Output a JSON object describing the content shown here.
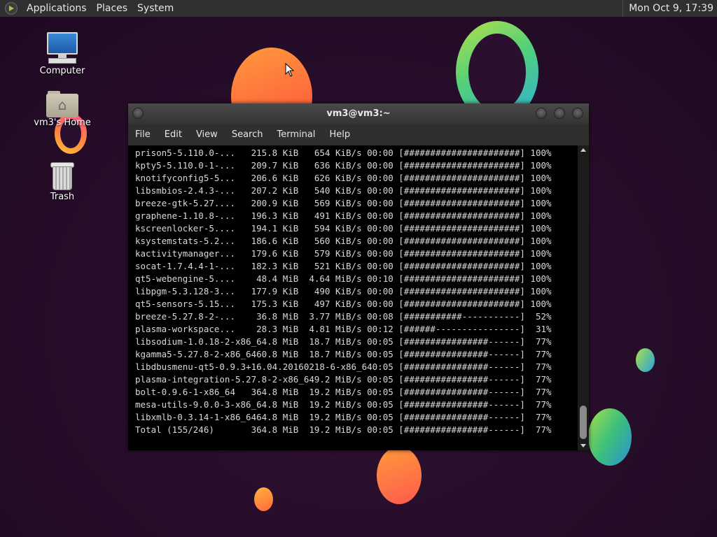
{
  "panel": {
    "menus": [
      "Applications",
      "Places",
      "System"
    ],
    "clock": "Mon Oct  9, 17:39"
  },
  "desktop": {
    "icons": [
      {
        "label": "Computer",
        "icon": "computer-icon"
      },
      {
        "label": "vm3's Home",
        "icon": "home-folder-icon"
      },
      {
        "label": "Trash",
        "icon": "trash-icon"
      }
    ]
  },
  "terminal": {
    "title": "vm3@vm3:~",
    "menus": [
      "File",
      "Edit",
      "View",
      "Search",
      "Terminal",
      "Help"
    ],
    "lines": [
      "prison5-5.110.0-...   215.8 KiB   654 KiB/s 00:00 [######################] 100%",
      "kpty5-5.110.0-1-...   209.7 KiB   636 KiB/s 00:00 [######################] 100%",
      "knotifyconfig5-5...   206.6 KiB   626 KiB/s 00:00 [######################] 100%",
      "libsmbios-2.4.3-...   207.2 KiB   540 KiB/s 00:00 [######################] 100%",
      "breeze-gtk-5.27....   200.9 KiB   569 KiB/s 00:00 [######################] 100%",
      "graphene-1.10.8-...   196.3 KiB   491 KiB/s 00:00 [######################] 100%",
      "kscreenlocker-5....   194.1 KiB   594 KiB/s 00:00 [######################] 100%",
      "ksystemstats-5.2...   186.6 KiB   560 KiB/s 00:00 [######################] 100%",
      "kactivitymanager...   179.6 KiB   579 KiB/s 00:00 [######################] 100%",
      "socat-1.7.4.4-1-...   182.3 KiB   521 KiB/s 00:00 [######################] 100%",
      "qt5-webengine-5....    48.4 MiB  4.64 MiB/s 00:10 [######################] 100%",
      "libpgm-5.3.128-3...   177.9 KiB   490 KiB/s 00:00 [######################] 100%",
      "qt5-sensors-5.15...   175.3 KiB   497 KiB/s 00:00 [######################] 100%",
      "breeze-5.27.8-2-...    36.8 MiB  3.77 MiB/s 00:08 [###########-----------]  52%",
      "plasma-workspace...    28.3 MiB  4.81 MiB/s 00:12 [######----------------]  31%",
      "libsodium-1.0.18-2-x86_64.8 MiB  18.7 MiB/s 00:05 [################------]  77%",
      "kgamma5-5.27.8-2-x86_6460.8 MiB  18.7 MiB/s 00:05 [################------]  77%",
      "libdbusmenu-qt5-0.9.3+16.04.20160218-6-x86_640:05 [################------]  77%",
      "plasma-integration-5.27.8-2-x86_649.2 MiB/s 00:05 [################------]  77%",
      "bolt-0.9.6-1-x86_64   364.8 MiB  19.2 MiB/s 00:05 [################------]  77%",
      "mesa-utils-9.0.0-3-x86_64.8 MiB  19.2 MiB/s 00:05 [################------]  77%",
      "libxmlb-0.3.14-1-x86_6464.8 MiB  19.2 MiB/s 00:05 [################------]  77%",
      "Total (155/246)       364.8 MiB  19.2 MiB/s 00:05 [################------]  77%"
    ]
  }
}
